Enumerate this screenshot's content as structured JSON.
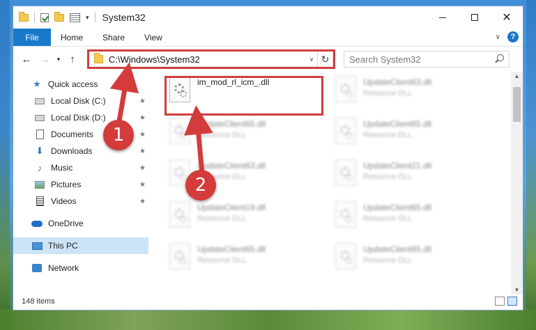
{
  "window": {
    "title": "System32"
  },
  "ribbon": {
    "tabs": [
      "File",
      "Home",
      "Share",
      "View"
    ]
  },
  "navigation": {
    "address": "C:\\Windows\\System32",
    "search_placeholder": "Search System32"
  },
  "sidebar": {
    "items": [
      {
        "label": "Quick access",
        "icon": "star-icon",
        "pinned": false
      },
      {
        "label": "Local Disk (C:)",
        "icon": "drive-icon",
        "pinned": true
      },
      {
        "label": "Local Disk (D:)",
        "icon": "drive-icon",
        "pinned": true
      },
      {
        "label": "Documents",
        "icon": "document-icon",
        "pinned": true
      },
      {
        "label": "Downloads",
        "icon": "download-icon",
        "pinned": true
      },
      {
        "label": "Music",
        "icon": "music-icon",
        "pinned": true
      },
      {
        "label": "Pictures",
        "icon": "pictures-icon",
        "pinned": true
      },
      {
        "label": "Videos",
        "icon": "videos-icon",
        "pinned": true
      },
      {
        "label": "OneDrive",
        "icon": "cloud-icon",
        "pinned": false
      },
      {
        "label": "This PC",
        "icon": "computer-icon",
        "pinned": false,
        "selected": true
      },
      {
        "label": "Network",
        "icon": "network-icon",
        "pinned": false
      }
    ]
  },
  "files": [
    {
      "name": "im_mod_rl_icm_.dll",
      "type": ""
    },
    {
      "name": "UpdateClient63.dll",
      "type": "Resource DLL"
    },
    {
      "name": "UpdateClient65.dll",
      "type": "Resource DLL"
    },
    {
      "name": "UpdateClient65.dll",
      "type": "Resource DLL"
    },
    {
      "name": "UpdateClient63.dll",
      "type": "Resource DLL"
    },
    {
      "name": "UpdateClient21.dll",
      "type": "Resource DLL"
    },
    {
      "name": "UpdateClient19.dll",
      "type": "Resource DLL"
    },
    {
      "name": "UpdateClient65.dll",
      "type": "Resource DLL"
    },
    {
      "name": "UpdateClient65.dll",
      "type": "Resource DLL"
    },
    {
      "name": "UpdateClient65.dll",
      "type": "Resource DLL"
    }
  ],
  "status": {
    "item_count": "148 items"
  },
  "annotations": {
    "step1": "1",
    "step2": "2",
    "color": "#cf3d3d"
  }
}
